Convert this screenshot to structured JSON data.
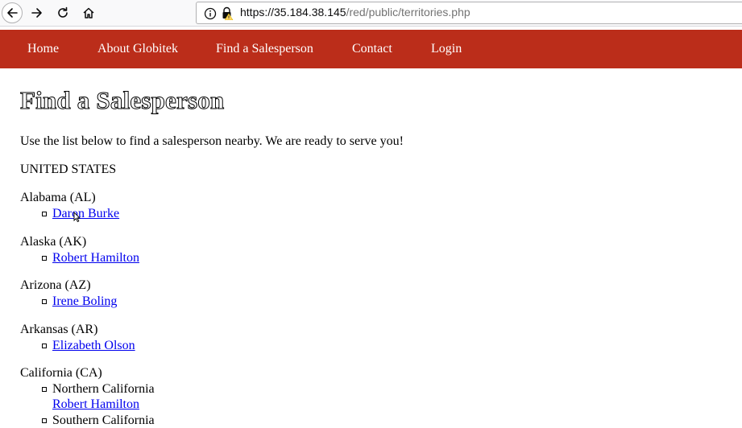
{
  "browser": {
    "url_host_part": "https://35.184.38.145",
    "url_path_part": "/red/public/territories.php"
  },
  "nav": {
    "home": "Home",
    "about": "About Globitek",
    "find": "Find a Salesperson",
    "contact": "Contact",
    "login": "Login"
  },
  "page": {
    "title": "Find a Salesperson",
    "intro": "Use the list below to find a salesperson nearby. We are ready to serve you!",
    "country": "UNITED STATES",
    "states": [
      {
        "name": "Alabama (AL)",
        "salespeople": [
          "Daron Burke"
        ]
      },
      {
        "name": "Alaska (AK)",
        "salespeople": [
          "Robert Hamilton"
        ]
      },
      {
        "name": "Arizona (AZ)",
        "salespeople": [
          "Irene Boling"
        ]
      },
      {
        "name": "Arkansas (AR)",
        "salespeople": [
          "Elizabeth Olson"
        ]
      },
      {
        "name": "California (CA)",
        "regions": [
          {
            "name": "Northern California",
            "salespeople": [
              "Robert Hamilton"
            ]
          },
          {
            "name": "Southern California"
          }
        ]
      }
    ]
  },
  "icons": {
    "back": "back-arrow-icon",
    "forward": "forward-arrow-icon",
    "reload": "reload-icon",
    "home": "home-icon",
    "info": "info-icon",
    "lock": "insecure-lock-icon"
  },
  "colors": {
    "nav_bg": "#bb2d1a",
    "link": "#0000ee"
  }
}
